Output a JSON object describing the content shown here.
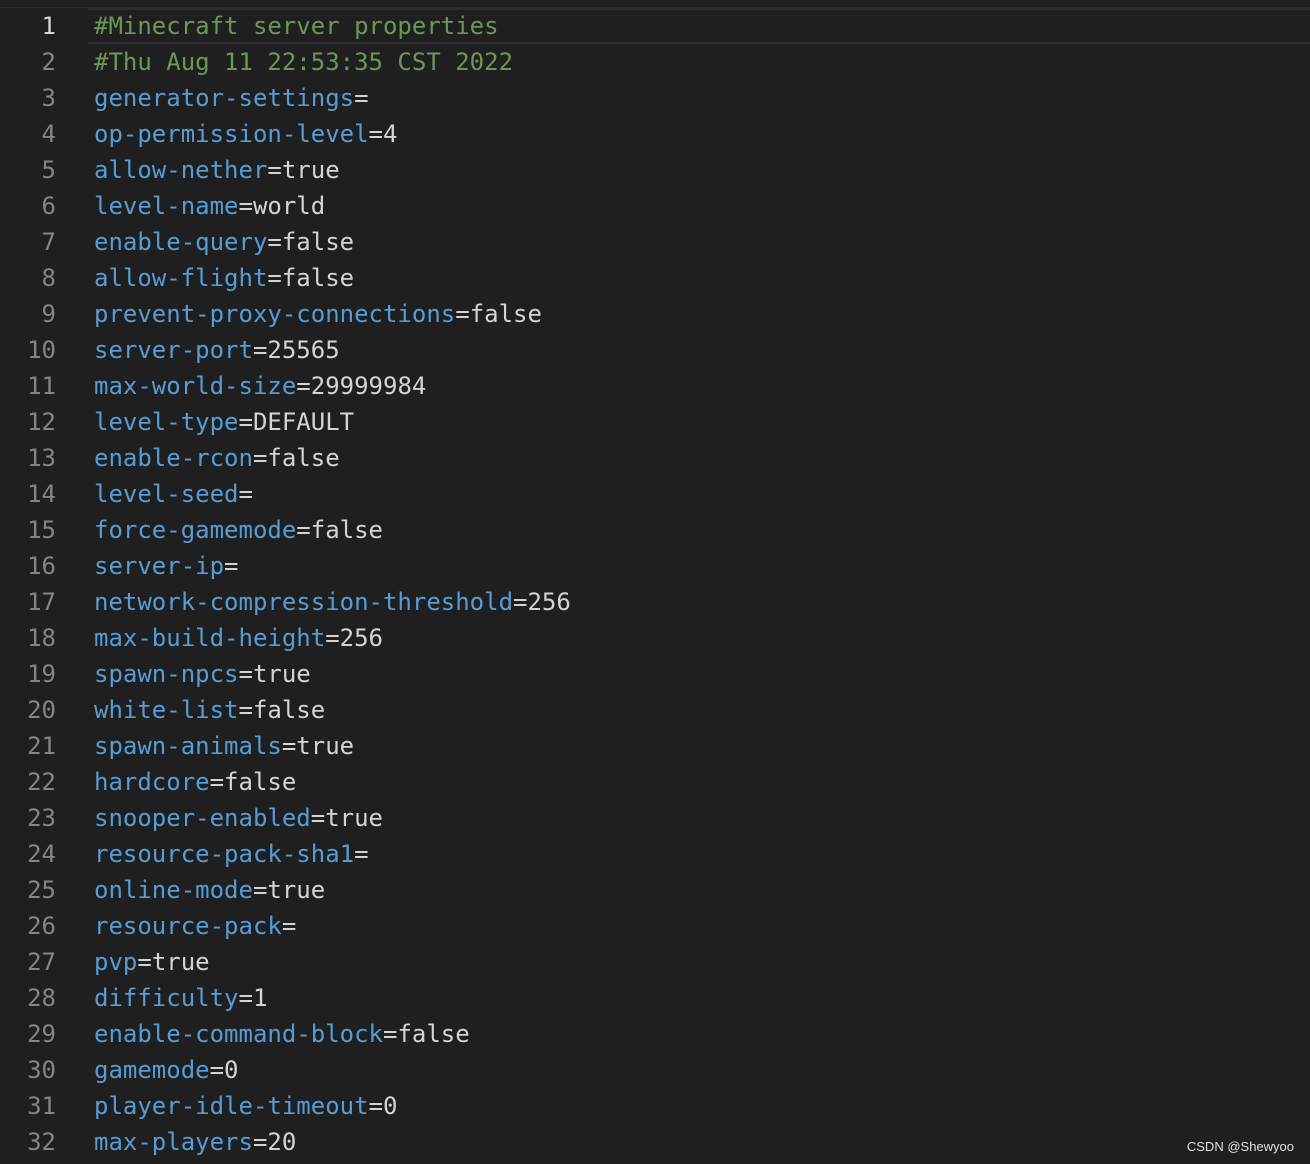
{
  "editor": {
    "lines": [
      {
        "n": "1",
        "text": "#Minecraft server properties",
        "comment": true
      },
      {
        "n": "2",
        "text": "#Thu Aug 11 22:53:35 CST 2022",
        "comment": true
      },
      {
        "n": "3",
        "key": "generator-settings",
        "value": ""
      },
      {
        "n": "4",
        "key": "op-permission-level",
        "value": "4"
      },
      {
        "n": "5",
        "key": "allow-nether",
        "value": "true"
      },
      {
        "n": "6",
        "key": "level-name",
        "value": "world"
      },
      {
        "n": "7",
        "key": "enable-query",
        "value": "false"
      },
      {
        "n": "8",
        "key": "allow-flight",
        "value": "false"
      },
      {
        "n": "9",
        "key": "prevent-proxy-connections",
        "value": "false"
      },
      {
        "n": "10",
        "key": "server-port",
        "value": "25565"
      },
      {
        "n": "11",
        "key": "max-world-size",
        "value": "29999984"
      },
      {
        "n": "12",
        "key": "level-type",
        "value": "DEFAULT"
      },
      {
        "n": "13",
        "key": "enable-rcon",
        "value": "false"
      },
      {
        "n": "14",
        "key": "level-seed",
        "value": ""
      },
      {
        "n": "15",
        "key": "force-gamemode",
        "value": "false"
      },
      {
        "n": "16",
        "key": "server-ip",
        "value": ""
      },
      {
        "n": "17",
        "key": "network-compression-threshold",
        "value": "256"
      },
      {
        "n": "18",
        "key": "max-build-height",
        "value": "256"
      },
      {
        "n": "19",
        "key": "spawn-npcs",
        "value": "true"
      },
      {
        "n": "20",
        "key": "white-list",
        "value": "false"
      },
      {
        "n": "21",
        "key": "spawn-animals",
        "value": "true"
      },
      {
        "n": "22",
        "key": "hardcore",
        "value": "false"
      },
      {
        "n": "23",
        "key": "snooper-enabled",
        "value": "true"
      },
      {
        "n": "24",
        "key": "resource-pack-sha1",
        "value": ""
      },
      {
        "n": "25",
        "key": "online-mode",
        "value": "true"
      },
      {
        "n": "26",
        "key": "resource-pack",
        "value": ""
      },
      {
        "n": "27",
        "key": "pvp",
        "value": "true"
      },
      {
        "n": "28",
        "key": "difficulty",
        "value": "1"
      },
      {
        "n": "29",
        "key": "enable-command-block",
        "value": "false"
      },
      {
        "n": "30",
        "key": "gamemode",
        "value": "0"
      },
      {
        "n": "31",
        "key": "player-idle-timeout",
        "value": "0"
      },
      {
        "n": "32",
        "key": "max-players",
        "value": "20"
      }
    ],
    "equals_sign": "=",
    "current_line": "1"
  },
  "watermark": "CSDN @Shewyoo",
  "colors": {
    "background": "#1f1f1f",
    "comment": "#6a9955",
    "key": "#569cd6",
    "value": "#d4d4d4",
    "line_number": "#858585"
  }
}
